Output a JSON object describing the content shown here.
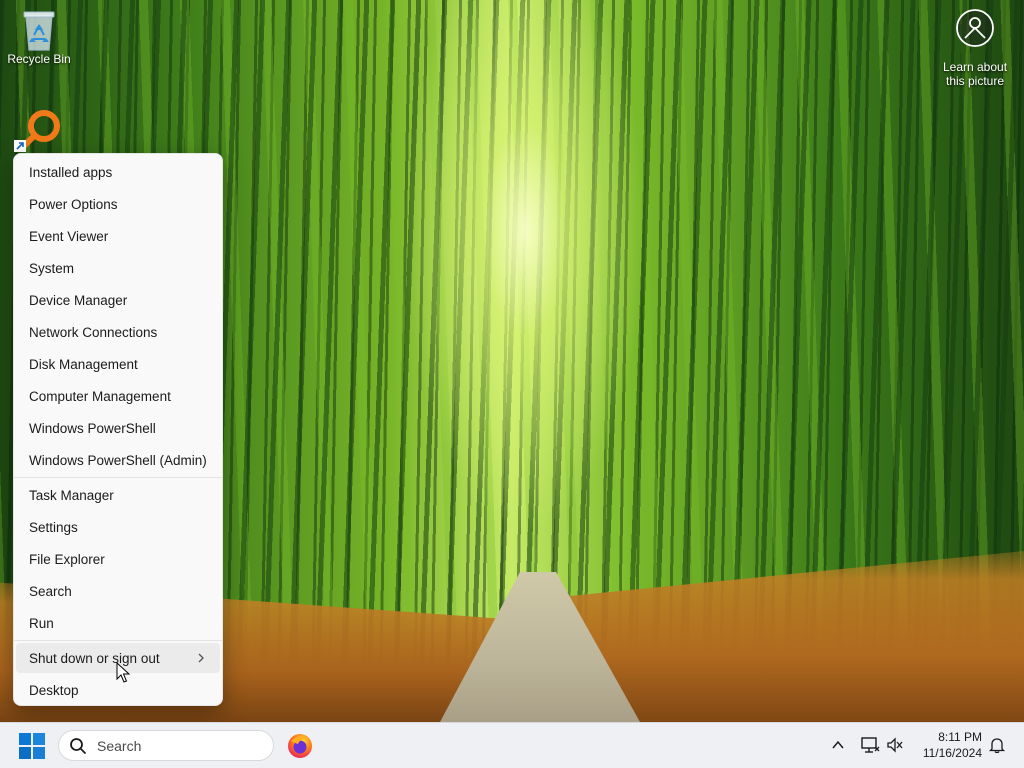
{
  "desktop": {
    "recycle_bin_label": "Recycle Bin",
    "learn_picture_label_1": "Learn about",
    "learn_picture_label_2": "this picture"
  },
  "context_menu": {
    "items": [
      {
        "label": "Installed apps"
      },
      {
        "label": "Power Options"
      },
      {
        "label": "Event Viewer"
      },
      {
        "label": "System"
      },
      {
        "label": "Device Manager"
      },
      {
        "label": "Network Connections"
      },
      {
        "label": "Disk Management"
      },
      {
        "label": "Computer Management"
      },
      {
        "label": "Windows PowerShell"
      },
      {
        "label": "Windows PowerShell (Admin)"
      },
      {
        "label": "Task Manager"
      },
      {
        "label": "Settings"
      },
      {
        "label": "File Explorer"
      },
      {
        "label": "Search"
      },
      {
        "label": "Run"
      },
      {
        "label": "Shut down or sign out"
      },
      {
        "label": "Desktop"
      }
    ]
  },
  "taskbar": {
    "search_placeholder": "Search",
    "clock_time": "8:11 PM",
    "clock_date": "11/16/2024"
  },
  "icons": {
    "start": "windows-logo-icon",
    "search": "search-icon",
    "browser": "firefox-icon",
    "tray_overflow": "chevron-up-icon",
    "network": "network-icon",
    "volume": "volume-muted-icon",
    "notifications": "bell-icon"
  },
  "colors": {
    "accent": "#0067c0",
    "menu_background": "#f9f9f9",
    "taskbar_background": "#eef0f3"
  }
}
